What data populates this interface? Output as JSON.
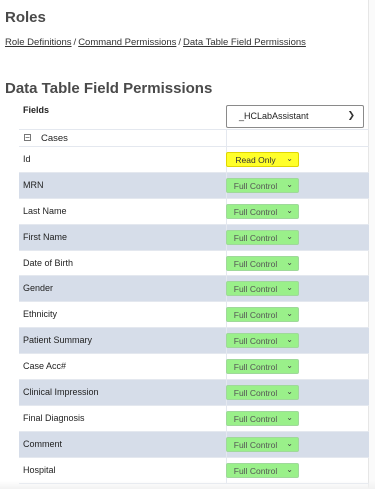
{
  "page": {
    "title": "Roles",
    "breadcrumb": [
      "Role Definitions",
      "Command Permissions",
      "Data Table Field Permissions"
    ],
    "breadcrumb_sep": "/",
    "section_title": "Data Table Field Permissions"
  },
  "grid": {
    "fields_header": "Fields",
    "role_select": {
      "value": "_HCLabAssistant",
      "icon": "chevron-down-icon"
    },
    "group": {
      "toggle": "⊟",
      "label": "Cases"
    },
    "rows": [
      {
        "field": "Id",
        "permission": "Read Only",
        "color": "#ffff2a"
      },
      {
        "field": "MRN",
        "permission": "Full Control",
        "color": "#9af08a"
      },
      {
        "field": "Last Name",
        "permission": "Full Control",
        "color": "#9af08a"
      },
      {
        "field": "First Name",
        "permission": "Full Control",
        "color": "#9af08a"
      },
      {
        "field": "Date of Birth",
        "permission": "Full Control",
        "color": "#9af08a"
      },
      {
        "field": "Gender",
        "permission": "Full Control",
        "color": "#9af08a"
      },
      {
        "field": "Ethnicity",
        "permission": "Full Control",
        "color": "#9af08a"
      },
      {
        "field": "Patient Summary",
        "permission": "Full Control",
        "color": "#9af08a"
      },
      {
        "field": "Case Acc#",
        "permission": "Full Control",
        "color": "#9af08a"
      },
      {
        "field": "Clinical Impression",
        "permission": "Full Control",
        "color": "#9af08a"
      },
      {
        "field": "Final Diagnosis",
        "permission": "Full Control",
        "color": "#9af08a"
      },
      {
        "field": "Comment",
        "permission": "Full Control",
        "color": "#9af08a"
      },
      {
        "field": "Hospital",
        "permission": "Full Control",
        "color": "#9af08a"
      }
    ]
  },
  "colors": {
    "alt_row": "#d6dde9",
    "full_control": "#9af08a",
    "read_only": "#ffff2a"
  }
}
